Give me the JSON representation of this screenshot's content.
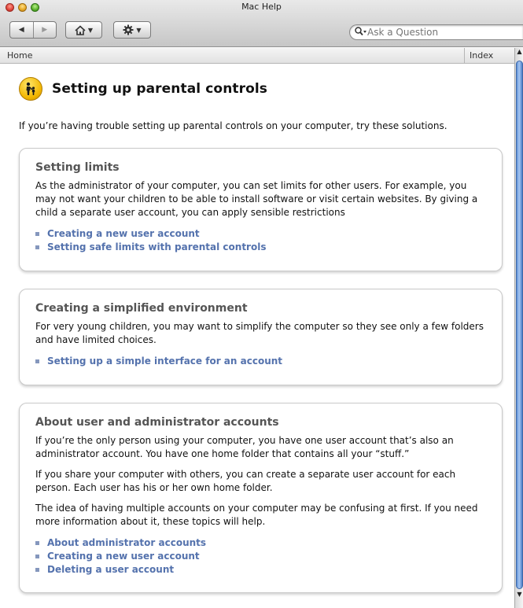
{
  "window": {
    "title": "Mac Help"
  },
  "toolbar": {
    "back_label": "◀",
    "forward_label": "▶",
    "home_icon": "home-icon",
    "gear_icon": "gear-icon"
  },
  "search": {
    "placeholder": "Ask a Question",
    "value": ""
  },
  "breadcrumb": {
    "home": "Home",
    "index": "Index"
  },
  "page": {
    "title": "Setting up parental controls",
    "intro": "If you’re having trouble setting up parental controls on your computer, try these solutions.",
    "sections": [
      {
        "heading": "Setting limits",
        "paragraphs": [
          "As the administrator of your computer, you can set limits for other users. For example, you may not want your children to be able to install software or visit certain websites. By giving a child a separate user account, you can apply sensible restrictions"
        ],
        "links": [
          "Creating a new user account",
          "Setting safe limits with parental controls"
        ]
      },
      {
        "heading": "Creating a simplified environment",
        "paragraphs": [
          "For very young children, you may want to simplify the computer so they see only a few folders and have limited choices."
        ],
        "links": [
          "Setting up a simple interface for an account"
        ]
      },
      {
        "heading": "About user and administrator accounts",
        "paragraphs": [
          "If you’re the only person using your computer, you have one user account that’s also an administrator account. You have one home folder that contains all your “stuff.”",
          "If you share your computer with others, you can create a separate user account for each person. Each user has his or her own home folder.",
          "The idea of having multiple accounts on your computer may be confusing at first. If you need more information about it, these topics will help."
        ],
        "links": [
          "About administrator accounts",
          "Creating a new user account",
          "Deleting a user account"
        ]
      }
    ]
  }
}
